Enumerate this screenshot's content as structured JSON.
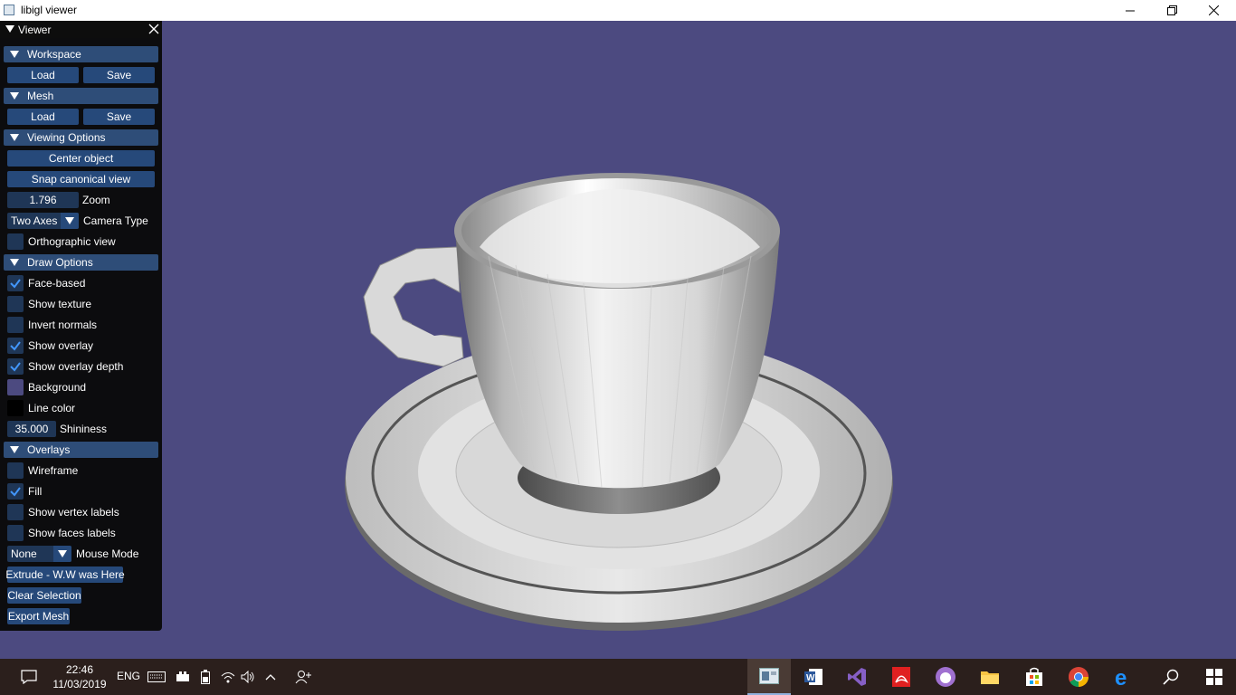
{
  "window": {
    "title": "libigl viewer"
  },
  "panel": {
    "title": "Viewer",
    "workspace": {
      "header": "Workspace",
      "load": "Load",
      "save": "Save"
    },
    "mesh": {
      "header": "Mesh",
      "load": "Load",
      "save": "Save"
    },
    "viewing": {
      "header": "Viewing Options",
      "center": "Center object",
      "snap": "Snap canonical view",
      "zoom_value": "1.796",
      "zoom_label": "Zoom",
      "camera_value": "Two Axes",
      "camera_label": "Camera Type",
      "ortho_label": "Orthographic view",
      "ortho_checked": false
    },
    "draw": {
      "header": "Draw Options",
      "items": [
        {
          "label": "Face-based",
          "checked": true
        },
        {
          "label": "Show texture",
          "checked": false
        },
        {
          "label": "Invert normals",
          "checked": false
        },
        {
          "label": "Show overlay",
          "checked": true
        },
        {
          "label": "Show overlay depth",
          "checked": true
        }
      ],
      "background_label": "Background",
      "background_color": "#4c4a80",
      "line_color_label": "Line color",
      "line_color": "#000000",
      "shininess_value": "35.000",
      "shininess_label": "Shininess"
    },
    "overlays": {
      "header": "Overlays",
      "items": [
        {
          "label": "Wireframe",
          "checked": false
        },
        {
          "label": "Fill",
          "checked": true
        },
        {
          "label": "Show vertex labels",
          "checked": false
        },
        {
          "label": "Show faces labels",
          "checked": false
        }
      ],
      "mouse_value": "None",
      "mouse_label": "Mouse Mode",
      "extrude": "Extrude - W.W was Here",
      "clear": "Clear Selection",
      "export": "Export Mesh"
    }
  },
  "taskbar": {
    "time": "22:46",
    "date": "11/03/2019",
    "lang": "ENG"
  },
  "colors": {
    "accent": "#26497a",
    "header": "#2e4d78",
    "check": "#4296fa",
    "background": "#4c4a80"
  }
}
